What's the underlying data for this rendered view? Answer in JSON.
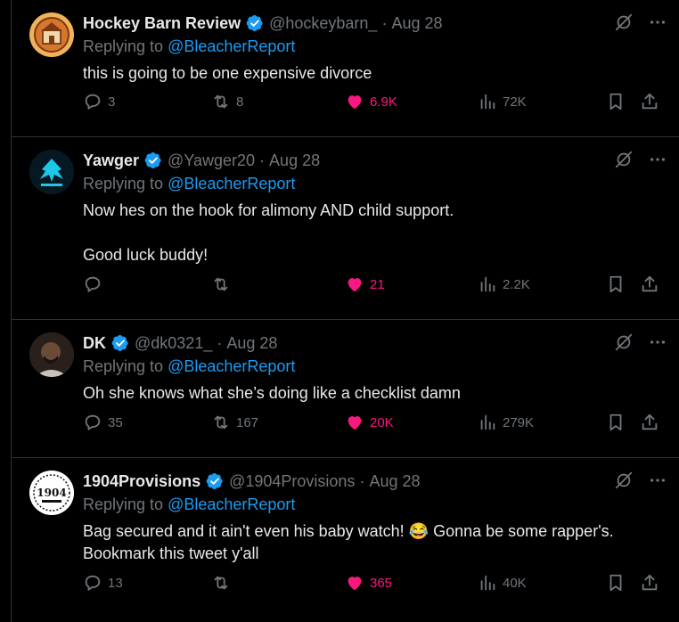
{
  "tweets": [
    {
      "name": "Hockey Barn Review",
      "handle": "@hockeybarn_",
      "time": "Aug 28",
      "reply_prefix": "Replying to",
      "reply_to": "@BleacherReport",
      "text": [
        "this is going to be one expensive divorce"
      ],
      "replies": "3",
      "reposts": "8",
      "likes": "6.9K",
      "views": "72K",
      "avatar_color": "#c87a2e"
    },
    {
      "name": "Yawger",
      "handle": "@Yawger20",
      "time": "Aug 28",
      "reply_prefix": "Replying to",
      "reply_to": "@BleacherReport",
      "text": [
        "Now hes on the hook for alimony AND child support.",
        "",
        "Good luck buddy!"
      ],
      "replies": "",
      "reposts": "",
      "likes": "21",
      "views": "2.2K",
      "avatar_color": "#0c2a3a"
    },
    {
      "name": "DK",
      "handle": "@dk0321_",
      "time": "Aug 28",
      "reply_prefix": "Replying to",
      "reply_to": "@BleacherReport",
      "text": [
        "Oh she knows what she’s doing like a checklist damn"
      ],
      "replies": "35",
      "reposts": "167",
      "likes": "20K",
      "views": "279K",
      "avatar_color": "#3b2a22"
    },
    {
      "name": "1904Provisions",
      "handle": "@1904Provisions",
      "time": "Aug 28",
      "reply_prefix": "Replying to",
      "reply_to": "@BleacherReport",
      "text": [
        "Bag secured and it ain't even his baby watch! 😂 Gonna be some rapper's.",
        "Bookmark this tweet y'all"
      ],
      "replies": "13",
      "reposts": "",
      "likes": "365",
      "views": "40K",
      "avatar_color": "#ffffff",
      "avatar_text": "1904"
    }
  ],
  "colors": {
    "background": "#000000",
    "text": "#e7e9ea",
    "muted": "#71767b",
    "link": "#1d9bf0",
    "like": "#f91880",
    "verified": "#1d9bf0"
  },
  "icons": [
    "verified-badge-icon",
    "grok-icon",
    "more-icon",
    "reply-icon",
    "repost-icon",
    "heart-icon",
    "views-icon",
    "bookmark-icon",
    "share-icon"
  ]
}
